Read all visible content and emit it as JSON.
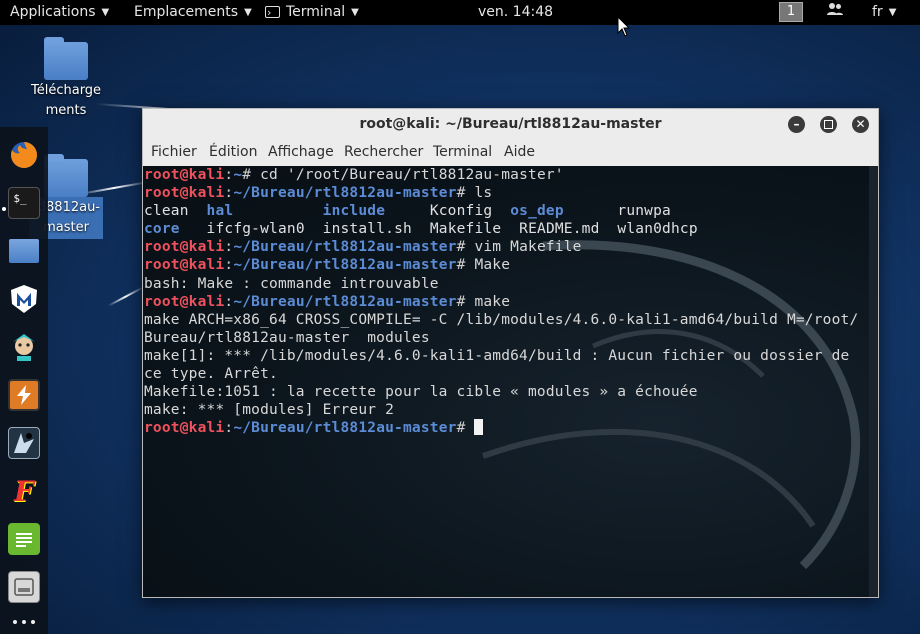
{
  "topbar": {
    "applications": "Applications",
    "places": "Emplacements",
    "terminal": "Terminal",
    "clock": "ven. 14:48",
    "workspace": "1",
    "language": "fr"
  },
  "desktop": {
    "icons": [
      {
        "label_line1": "Télécharge",
        "label_line2": "ments"
      },
      {
        "label_line1": "rtl8812au-",
        "label_line2": "master"
      }
    ]
  },
  "dock": {
    "items": [
      "firefox-icon",
      "terminal-icon",
      "files-icon",
      "metasploit-icon",
      "armitage-icon",
      "burpsuite-icon",
      "beef-icon",
      "faraday-icon",
      "leafpad-icon",
      "keepnote-icon",
      "show-apps-icon"
    ]
  },
  "window": {
    "title": "root@kali: ~/Bureau/rtl8812au-master",
    "menu": [
      "Fichier",
      "Édition",
      "Affichage",
      "Rechercher",
      "Terminal",
      "Aide"
    ]
  },
  "terminal": {
    "prompt_user": "root@kali",
    "home_path": "~",
    "project_path": "~/Bureau/rtl8812au-master",
    "cmd1": "cd '/root/Bureau/rtl8812au-master'",
    "cmd2": "ls",
    "ls_row1": [
      {
        "text": "clean",
        "kind": "file",
        "pad": "  "
      },
      {
        "text": "hal",
        "kind": "dir",
        "pad": "          "
      },
      {
        "text": "include",
        "kind": "dir",
        "pad": "     "
      },
      {
        "text": "Kconfig",
        "kind": "file",
        "pad": "  "
      },
      {
        "text": "os_dep",
        "kind": "dir",
        "pad": "      "
      },
      {
        "text": "runwpa",
        "kind": "file",
        "pad": ""
      }
    ],
    "ls_row2": [
      {
        "text": "core",
        "kind": "dir",
        "pad": "   "
      },
      {
        "text": "ifcfg-wlan0",
        "kind": "file",
        "pad": "  "
      },
      {
        "text": "install.sh",
        "kind": "file",
        "pad": "  "
      },
      {
        "text": "Makefile",
        "kind": "file",
        "pad": "  "
      },
      {
        "text": "README.md",
        "kind": "file",
        "pad": "  "
      },
      {
        "text": "wlan0dhcp",
        "kind": "file",
        "pad": ""
      }
    ],
    "cmd3": "vim Makefile",
    "cmd4": "Make",
    "out4": "bash: Make : commande introuvable",
    "cmd5": "make",
    "out5_1": "make ARCH=x86_64 CROSS_COMPILE= -C /lib/modules/4.6.0-kali1-amd64/build M=/root/",
    "out5_2": "Bureau/rtl8812au-master  modules",
    "out5_3": "make[1]: *** /lib/modules/4.6.0-kali1-amd64/build : Aucun fichier ou dossier de",
    "out5_4": "ce type. Arrêt.",
    "out5_5": "Makefile:1051 : la recette pour la cible « modules » a échouée",
    "out5_6": "make: *** [modules] Erreur 2"
  }
}
